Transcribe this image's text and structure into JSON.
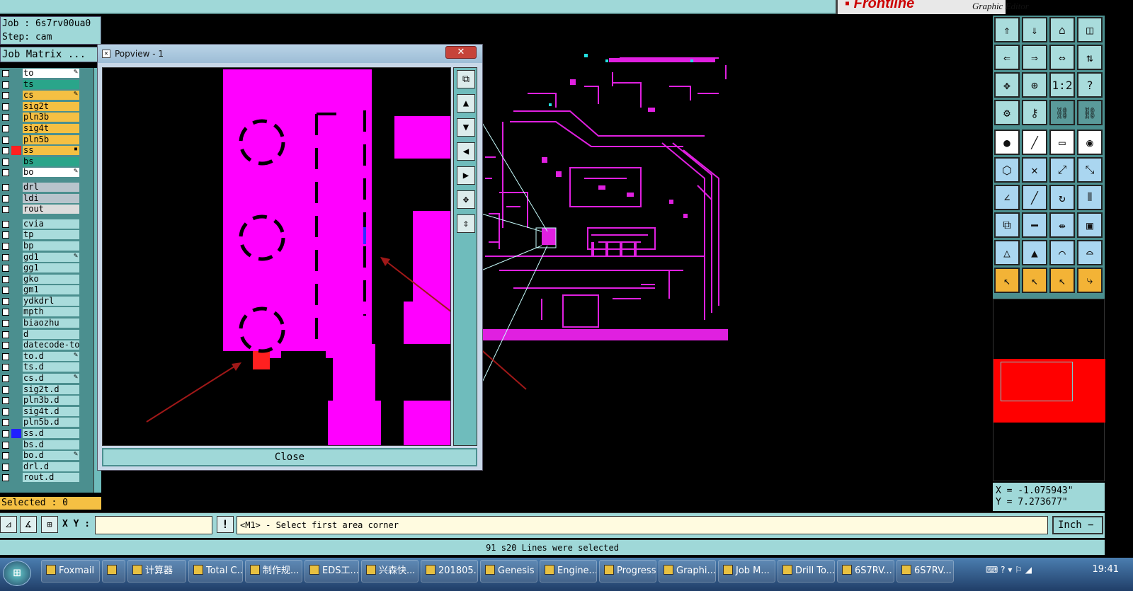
{
  "app": {
    "header_subtitle": "Graphic Editor",
    "logo": "Frontline"
  },
  "job": {
    "line": "Job : 6s7rv00ua0",
    "step": "Step: cam",
    "matrix_title": "Job Matrix ..."
  },
  "layers": [
    {
      "name": "to",
      "color": "#ffffff",
      "mark": "✎"
    },
    {
      "name": "ts",
      "color": "#2aa58a"
    },
    {
      "name": "cs",
      "color": "#f5c043",
      "mark": "✎"
    },
    {
      "name": "sig2t",
      "color": "#f5c043"
    },
    {
      "name": "pln3b",
      "color": "#f5c043"
    },
    {
      "name": "sig4t",
      "color": "#f5c043"
    },
    {
      "name": "pln5b",
      "color": "#f5c043"
    },
    {
      "name": "ss",
      "color": "#f5c043",
      "sel": "#ff2020",
      "mark": "▪"
    },
    {
      "name": "bs",
      "color": "#2aa58a"
    },
    {
      "name": "bo",
      "color": "#ffffff",
      "mark": "✎"
    },
    {
      "sep": true
    },
    {
      "name": "drl",
      "color": "#b8c4cc"
    },
    {
      "name": "ldi",
      "color": "#b8c4cc"
    },
    {
      "name": "rout",
      "color": "#dcdcdc"
    },
    {
      "sep": true
    },
    {
      "name": "cvia",
      "color": "#a9dcdc"
    },
    {
      "name": "tp",
      "color": "#a9dcdc"
    },
    {
      "name": "bp",
      "color": "#a9dcdc"
    },
    {
      "name": "gd1",
      "color": "#a9dcdc",
      "mark": "✎"
    },
    {
      "name": "gg1",
      "color": "#a9dcdc"
    },
    {
      "name": "gko",
      "color": "#a9dcdc"
    },
    {
      "name": "gm1",
      "color": "#a9dcdc"
    },
    {
      "name": "ydkdrl",
      "color": "#a9dcdc"
    },
    {
      "name": "mpth",
      "color": "#a9dcdc"
    },
    {
      "name": "biaozhu",
      "color": "#a9dcdc"
    },
    {
      "name": "d",
      "color": "#a9dcdc"
    },
    {
      "name": "datecode-to",
      "color": "#a9dcdc"
    },
    {
      "name": "to.d",
      "color": "#a9dcdc",
      "mark": "✎"
    },
    {
      "name": "ts.d",
      "color": "#a9dcdc"
    },
    {
      "name": "cs.d",
      "color": "#a9dcdc",
      "mark": "✎"
    },
    {
      "name": "sig2t.d",
      "color": "#a9dcdc"
    },
    {
      "name": "pln3b.d",
      "color": "#a9dcdc"
    },
    {
      "name": "sig4t.d",
      "color": "#a9dcdc"
    },
    {
      "name": "pln5b.d",
      "color": "#a9dcdc"
    },
    {
      "name": "ss.d",
      "color": "#a9dcdc",
      "sel": "#2020ff"
    },
    {
      "name": "bs.d",
      "color": "#a9dcdc"
    },
    {
      "name": "bo.d",
      "color": "#a9dcdc",
      "mark": "✎"
    },
    {
      "name": "drl.d",
      "color": "#a9dcdc"
    },
    {
      "name": "rout.d",
      "color": "#a9dcdc"
    }
  ],
  "selected": "Selected : 0",
  "popview": {
    "title": "Popview - 1",
    "close_x": "✕",
    "close_label": "Close"
  },
  "coords": {
    "x": "X = -1.075943\"",
    "y": "Y = 7.273677\""
  },
  "cmd": {
    "xy_label": "X Y :",
    "xy_value": "",
    "prompt": "<M1> - Select first area corner",
    "units": "Inch −"
  },
  "status": "91 s20 Lines were selected",
  "taskbar": {
    "items": [
      "Foxmail",
      "",
      "计算器",
      "Total C...",
      "制作规...",
      "EDS工...",
      "兴森快...",
      "201805...",
      "Genesis",
      "Engine...",
      "Progress",
      "Graphi...",
      "Job M...",
      "Drill To...",
      "6S7RV...",
      "6S7RV..."
    ],
    "clock": "19:41"
  },
  "colors": {
    "panel": "#9fd8d8",
    "magenta": "#ff00ff",
    "red": "#ff0000"
  }
}
